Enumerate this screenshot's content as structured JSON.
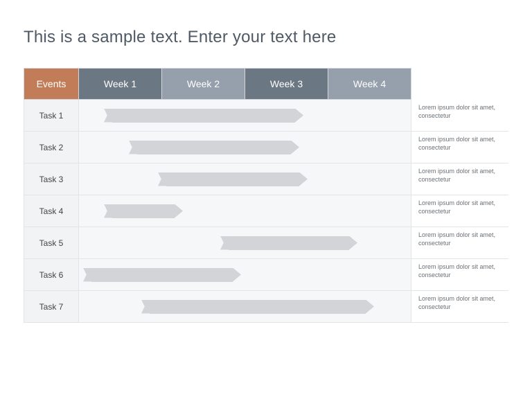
{
  "title": "This is a sample text. Enter your text here",
  "header": {
    "events_label": "Events",
    "weeks": [
      {
        "label": "Week 1",
        "bg": "#6c7784"
      },
      {
        "label": "Week 2",
        "bg": "#95a0ac"
      },
      {
        "label": "Week 3",
        "bg": "#6c7784"
      },
      {
        "label": "Week 4",
        "bg": "#95a0ac"
      }
    ]
  },
  "colors": {
    "events_head_bg": "#c27d58",
    "bar_fill": "#d2d4d7",
    "row_bg": "#f6f7f8"
  },
  "chart_data": {
    "type": "gantt",
    "title": "",
    "x_unit": "week",
    "x_range": [
      0,
      4
    ],
    "columns": [
      "Week 1",
      "Week 2",
      "Week 3",
      "Week 4"
    ],
    "tasks": [
      {
        "name": "Task 1",
        "start": 0.3,
        "end": 2.7,
        "desc": "Lorem ipsum dolor sit amet, consectetur"
      },
      {
        "name": "Task 2",
        "start": 0.6,
        "end": 2.65,
        "desc": "Lorem ipsum dolor sit amet, consectetur"
      },
      {
        "name": "Task 3",
        "start": 0.95,
        "end": 2.75,
        "desc": "Lorem ipsum dolor sit amet, consectetur"
      },
      {
        "name": "Task 4",
        "start": 0.3,
        "end": 1.25,
        "desc": "Lorem ipsum dolor sit amet, consectetur"
      },
      {
        "name": "Task 5",
        "start": 1.7,
        "end": 3.35,
        "desc": "Lorem ipsum dolor sit amet, consectetur"
      },
      {
        "name": "Task 6",
        "start": 0.05,
        "end": 1.95,
        "desc": "Lorem ipsum dolor sit amet, consectetur"
      },
      {
        "name": "Task 7",
        "start": 0.75,
        "end": 3.55,
        "desc": "Lorem ipsum dolor sit amet, consectetur"
      }
    ]
  }
}
